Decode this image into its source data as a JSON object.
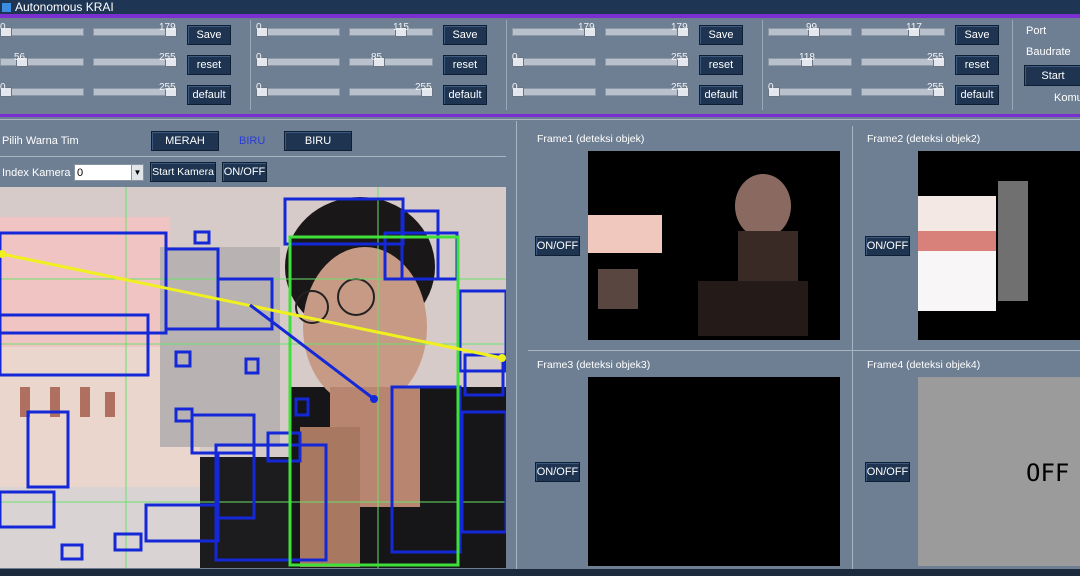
{
  "window": {
    "title": "Autonomous KRAI"
  },
  "slider_groups": [
    {
      "sliders": [
        {
          "label": "0",
          "pos": 0.0
        },
        {
          "label": "179",
          "pos": 1.0
        },
        {
          "label": "56",
          "pos": 0.22
        },
        {
          "label": "255",
          "pos": 1.0
        },
        {
          "label": "0",
          "pos": 0.0
        },
        {
          "label": "255",
          "pos": 1.0
        }
      ],
      "buttons": [
        "Save",
        "reset",
        "default"
      ]
    },
    {
      "sliders": [
        {
          "label": "0",
          "pos": 0.0
        },
        {
          "label": "115",
          "pos": 0.64
        },
        {
          "label": "0",
          "pos": 0.0
        },
        {
          "label": "85",
          "pos": 0.33
        },
        {
          "label": "0",
          "pos": 0.0
        },
        {
          "label": "255",
          "pos": 1.0
        }
      ],
      "buttons": [
        "Save",
        "reset",
        "default"
      ]
    },
    {
      "sliders": [
        {
          "label": "179",
          "pos": 1.0
        },
        {
          "label": "179",
          "pos": 1.0
        },
        {
          "label": "0",
          "pos": 0.0
        },
        {
          "label": "255",
          "pos": 1.0
        },
        {
          "label": "0",
          "pos": 0.0
        },
        {
          "label": "255",
          "pos": 1.0
        }
      ],
      "buttons": [
        "Save",
        "reset",
        "default"
      ]
    },
    {
      "sliders": [
        {
          "label": "99",
          "pos": 0.55
        },
        {
          "label": "117",
          "pos": 0.65
        },
        {
          "label": "118",
          "pos": 0.46
        },
        {
          "label": "255",
          "pos": 1.0
        },
        {
          "label": "0",
          "pos": 0.0
        },
        {
          "label": "255",
          "pos": 1.0
        }
      ],
      "buttons": [
        "Save",
        "reset",
        "default"
      ]
    }
  ],
  "serial": {
    "port_label": "Port",
    "baudrate_label": "Baudrate",
    "start_label": "Start",
    "komu_label": "Komu"
  },
  "team": {
    "label": "Pilih Warna Tim",
    "merah_button": "MERAH",
    "current": "BIRU",
    "biru_button": "BIRU"
  },
  "camera": {
    "index_label": "Index Kamera",
    "index_value": "0",
    "start_button": "Start Kamera",
    "onoff_button": "ON/OFF"
  },
  "frames": [
    {
      "title": "Frame1 (deteksi objek)",
      "onoff": "ON/OFF"
    },
    {
      "title": "Frame2 (deteksi objek2)",
      "onoff": "ON/OFF"
    },
    {
      "title": "Frame3 (deteksi objek3)",
      "onoff": "ON/OFF"
    },
    {
      "title": "Frame4 (deteksi objek4)",
      "onoff": "ON/OFF",
      "overlay_text": "OFF"
    }
  ],
  "colors": {
    "accent": "#7a2fd0",
    "titlebar": "#1f3554",
    "button": "#1e3450",
    "panel": "#6e7f93",
    "detect_blue": "#1428d8",
    "detect_green": "#3fe03a",
    "track_line": "#f0f020"
  }
}
